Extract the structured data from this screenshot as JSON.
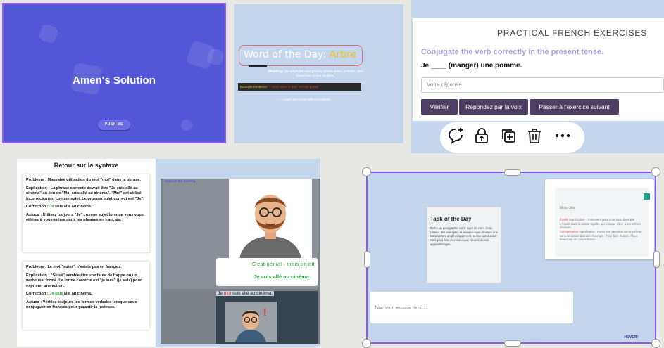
{
  "panel1": {
    "title": "Amen's Solution",
    "button": "PUSH ME"
  },
  "panel2": {
    "word_prefix": "Word of the Day: ",
    "word": "Arbre",
    "meaning_label": "Meaning:",
    "meaning_text": " Un arbre est une grande plante avec un tronc, des branches et des feuilles.",
    "example_label": "Example Sentence: ",
    "example_text": "\"L'arbre dans le parc est très grand.\"",
    "footer": "— Learn and Grow with Every Word"
  },
  "panel3": {
    "heading": "PRACTICAL FRENCH EXERCISES",
    "instruction": "Conjugate the verb correctly in the present tense.",
    "question": "Je ____ (manger) une pomme.",
    "input_placeholder": "Votre réponse",
    "btn_check": "Vérifier",
    "btn_voice": "Répondez par la voix",
    "btn_next": "Passer à l'exercice suivant",
    "toolbar_icons": [
      "comment-add-icon",
      "share-lock-icon",
      "copy-add-icon",
      "trash-icon",
      "more-icon"
    ]
  },
  "panel4": {
    "title": "Retour sur la syntaxe",
    "a_problem": "Problème : Mauvaise utilisation du mot \"moi\" dans la phrase.",
    "a_explanation": "Explication : La phrase correcte devrait être \"Je suis allé au cinéma\" au lieu de \"Moi suis allé au cinéma\". \"Moi\" est utilisé incorrectement comme sujet. Le pronom sujet correct est \"Je\".",
    "a_correction_label": "Correction : ",
    "a_correction_word": "Je",
    "a_correction_rest": " suis allé au cinéma.",
    "a_tip": "Astuce : Utilisez toujours \"Je\" comme sujet lorsque vous vous référez à vous-même dans les phrases en français.",
    "b_problem": "Problème : Le mot \"suisé\" n'existe pas en français.",
    "b_explanation": "Explication : \"Suisé\" semble être une faute de frappe ou un verbe mal formé. La forme correcte est \"je suis\" (je suis) pour exprimer une action.",
    "b_correction_label": "Correction : ",
    "b_correction_word": "Je suis",
    "b_correction_rest": " allé au cinéma.",
    "b_tip": "Astuce : Vérifiez toujours les formes verbales lorsque vous conjuguez en français pour garantir la justesse.",
    "tag": "Capturer Bot Desktop",
    "bubble_line1": "C'est génial ! mais on dit",
    "bubble_line2": "Je suis allé au cinéma.",
    "sent_word1": "Je",
    "sent_word2": "moi",
    "sent_rest": " suis allé au cinéma."
  },
  "panel5": {
    "task_title": "Task of the Day",
    "task_desc": "Écrire un paragraphe sur le sujet de votre choix. Utilisez des exemples et assurez-vous d'inclure une introduction, un développement, et une conclusion. Cela peut être un essai ou un résumé de vos apprentissages.",
    "mots_title": "Mots clés",
    "mots_word1": "Équité",
    "mots_def1": " Signification : Traitement juste pour tous. Exemple : L'équité dans la classe signifie que chaque élève a les mêmes chances.",
    "mots_word2": "Concentration",
    "mots_def2": " Signification : Porter son attention sur une tâche sans se laisser distraire. Exemple : Pour bien étudier, il faut beaucoup de concentration...",
    "message_placeholder": "Type your message here...",
    "hover_label": "HOVER!"
  }
}
